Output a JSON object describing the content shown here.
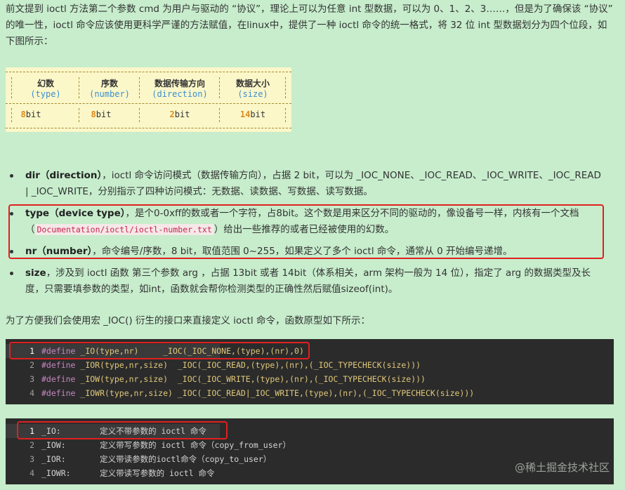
{
  "intro": "前文提到 ioctl 方法第二个参数 cmd 为用户与驱动的 “协议”，理论上可以为任意 int 型数据，可以为 0、1、2、3……，但是为了确保该 “协议” 的唯一性，ioctl 命令应该使用更科学严谨的方法赋值，在linux中，提供了一种 ioctl 命令的统一格式，将 32 位 int 型数据划分为四个位段，如下图所示：",
  "format_table": {
    "columns": [
      {
        "name": "幻数",
        "en": "(type)",
        "bits": "8",
        "unit": "bit"
      },
      {
        "name": "序数",
        "en": "(number)",
        "bits": "8",
        "unit": "bit"
      },
      {
        "name": "数据传输方向",
        "en": "(direction)",
        "bits": "2",
        "unit": "bit"
      },
      {
        "name": "数据大小",
        "en": "(size)",
        "bits": "14",
        "unit": "bit"
      }
    ]
  },
  "bullets": {
    "dir": {
      "term": "dir（direction）",
      "text": "，ioctl 命令访问模式（数据传输方向），占据 2 bit，可以为 _IOC_NONE、_IOC_READ、_IOC_WRITE、_IOC_READ | _IOC_WRITE，分别指示了四种访问模式：无数据、读数据、写数据、读写数据。"
    },
    "type": {
      "term": "type（device type）",
      "text_a": "，是个0-0xff的数或者一个字符，占8bit。这个数是用来区分不同的驱动的，像设备号一样，内核有一个文档（",
      "link": "Documentation/ioctl/ioctl-number.txt",
      "text_b": "）给出一些推荐的或者已经被使用的幻数。"
    },
    "nr": {
      "term": "nr（number）",
      "text": "，命令编号/序数，8 bit，取值范围 0~255，如果定义了多个 ioctl 命令，通常从 0 开始编号递增。"
    },
    "size": {
      "term": "size",
      "text": "，涉及到 ioctl 函数 第三个参数 arg ，占据 13bit 或者 14bit（体系相关，arm 架构一般为 14 位），指定了 arg 的数据类型及长度，只需要填参数的类型，如int，函数就会帮你检测类型的正确性然后赋值sizeof(int)。"
    }
  },
  "transition": "为了方便我们会使用宏 _IOC() 衍生的接口来直接定义 ioctl 命令，函数原型如下所示：",
  "code1": [
    {
      "n": "1",
      "kw": "#define",
      "rest": " _IO(type,nr)     _IOC(_IOC_NONE,(type),(nr),0)"
    },
    {
      "n": "2",
      "kw": "#define",
      "rest": " _IOR(type,nr,size)  _IOC(_IOC_READ,(type),(nr),(_IOC_TYPECHECK(size)))"
    },
    {
      "n": "3",
      "kw": "#define",
      "rest": " _IOW(type,nr,size)  _IOC(_IOC_WRITE,(type),(nr),(_IOC_TYPECHECK(size)))"
    },
    {
      "n": "4",
      "kw": "#define",
      "rest": " _IOWR(type,nr,size) _IOC(_IOC_READ|_IOC_WRITE,(type),(nr),(_IOC_TYPECHECK(size)))"
    }
  ],
  "code2": [
    {
      "n": "1",
      "text": "_IO:        定义不带参数的 ioctl 命令"
    },
    {
      "n": "2",
      "text": "_IOW:       定义带写参数的 ioctl 命令（copy_from_user）"
    },
    {
      "n": "3",
      "text": "_IOR:       定义带读参数的ioctl命令（copy_to_user）"
    },
    {
      "n": "4",
      "text": "_IOWR:      定义带读写参数的 ioctl 命令"
    }
  ],
  "watermark": "@稀土掘金技术社区"
}
